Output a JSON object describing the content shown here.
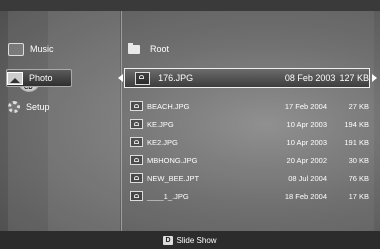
{
  "disc": {
    "label": "CD"
  },
  "menu": {
    "items": [
      {
        "label": "Music",
        "icon": "music-icon"
      },
      {
        "label": "Photo",
        "icon": "photo-icon",
        "selected": true
      },
      {
        "label": "Setup",
        "icon": "gear-icon"
      }
    ]
  },
  "browser": {
    "root_label": "Root",
    "selected": {
      "name": "176.JPG",
      "date": "08 Feb 2003",
      "size": "127 KB"
    },
    "files": [
      {
        "name": "BEACH.JPG",
        "date": "17 Feb 2004",
        "size": "27 KB"
      },
      {
        "name": "KE.JPG",
        "date": "10 Apr 2003",
        "size": "194 KB"
      },
      {
        "name": "KE2.JPG",
        "date": "10 Apr 2003",
        "size": "191 KB"
      },
      {
        "name": "MBHONG.JPG",
        "date": "20 Apr 2002",
        "size": "30 KB"
      },
      {
        "name": "NEW_BEE.JPT",
        "date": "08 Jul 2004",
        "size": "76 KB"
      },
      {
        "name": "____1_.JPG",
        "date": "18 Feb 2004",
        "size": "17 KB"
      }
    ]
  },
  "footer": {
    "key": "D",
    "hint": "Slide Show"
  }
}
